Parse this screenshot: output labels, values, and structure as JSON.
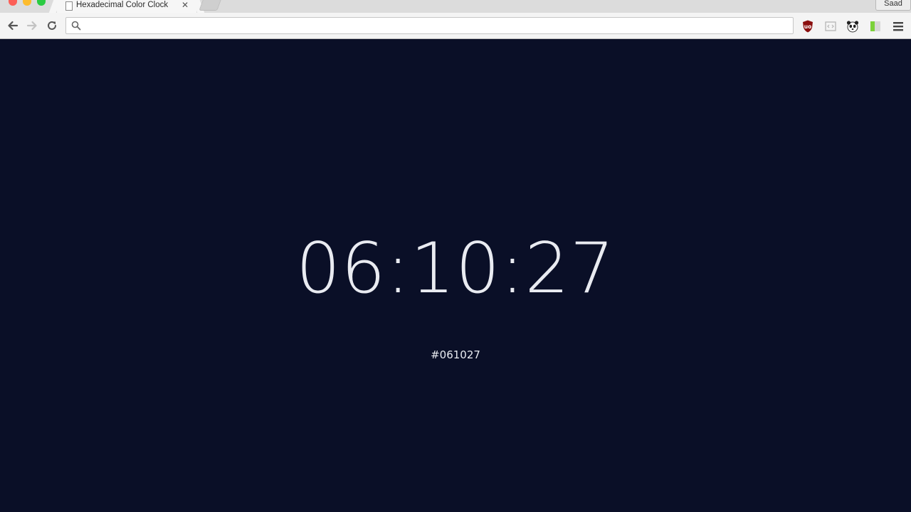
{
  "browser": {
    "tab": {
      "title": "Hexadecimal Color Clock",
      "close_glyph": "✕",
      "icon": "page-icon"
    },
    "profile_name": "Saad",
    "omnibox": {
      "value": "",
      "placeholder": "",
      "icon": "search-icon"
    },
    "toolbar_icons": [
      "back-arrow-icon",
      "forward-arrow-icon",
      "reload-icon",
      "ublock-icon",
      "code-icon",
      "panda-icon",
      "green-extension-icon",
      "menu-icon"
    ]
  },
  "page": {
    "background_color": "#0a0f27",
    "text_color": "#e9ebf1",
    "clock_time": "06:10:27",
    "hex_code": "#061027"
  }
}
